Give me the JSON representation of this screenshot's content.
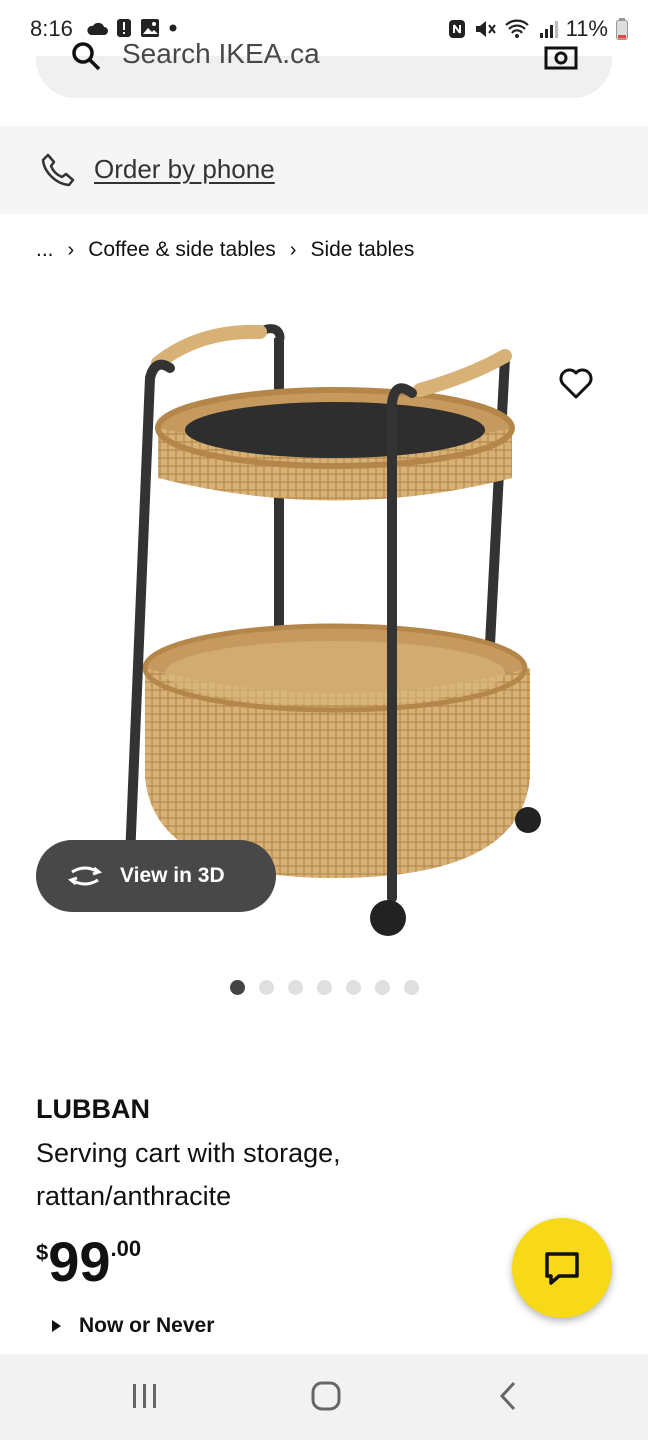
{
  "status_bar": {
    "time": "8:16",
    "battery": "11%",
    "icons": [
      "cloud-icon",
      "alert-icon",
      "image-icon",
      "dot-icon",
      "nfc-icon",
      "mute-icon",
      "wifi-icon",
      "signal-icon",
      "battery-icon"
    ]
  },
  "search": {
    "placeholder": "Search IKEA.ca",
    "icons": [
      "search-icon",
      "camera-icon"
    ]
  },
  "order": {
    "label": "Order by phone",
    "icon": "phone-icon"
  },
  "breadcrumb": {
    "ellipsis": "...",
    "items": [
      "Coffee & side tables",
      "Side tables"
    ]
  },
  "image": {
    "icon": "wishlist-heart-icon",
    "view3d_label": "View in 3D",
    "view3d_icon": "rotate-icon",
    "dot_count": 7,
    "active_dot": 0
  },
  "product": {
    "name": "LUBBAN",
    "description": "Serving cart with storage, rattan/anthracite",
    "price": {
      "currency": "$",
      "integer": "99",
      "decimal": ".00"
    },
    "tag": "Now or Never"
  },
  "chat": {
    "icon": "chat-icon",
    "color": "#f7d917"
  },
  "nav": {
    "icons": [
      "recents-icon",
      "home-icon",
      "back-icon"
    ]
  }
}
